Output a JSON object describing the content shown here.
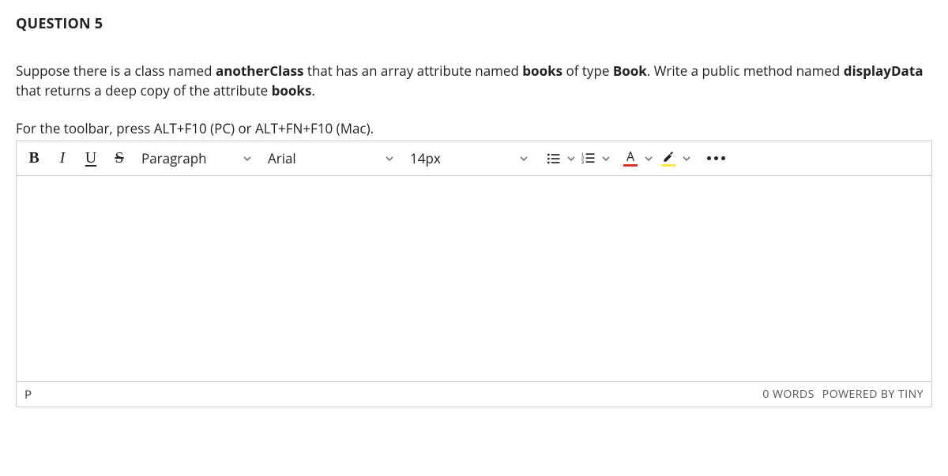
{
  "question": {
    "title": "QUESTION 5",
    "body_seg1": "Suppose there is a class named ",
    "body_b1": "anotherClass",
    "body_seg2": " that has an array attribute named ",
    "body_b2": "books",
    "body_seg3": " of type ",
    "body_b3": "Book",
    "body_seg4": ". Write a public method named ",
    "body_b4": "displayData",
    "body_seg5": "  that returns a deep copy of the attribute ",
    "body_b5": "books",
    "body_seg6": "."
  },
  "toolbar_hint": "For the toolbar, press ALT+F10 (PC) or ALT+FN+F10 (Mac).",
  "toolbar": {
    "bold": "B",
    "italic": "I",
    "underline": "U",
    "strike": "S",
    "block_format": "Paragraph",
    "font_family": "Arial",
    "font_size": "14px",
    "text_color_glyph": "A"
  },
  "status": {
    "path": "P",
    "words": "0 WORDS",
    "powered": "POWERED BY TINY"
  }
}
